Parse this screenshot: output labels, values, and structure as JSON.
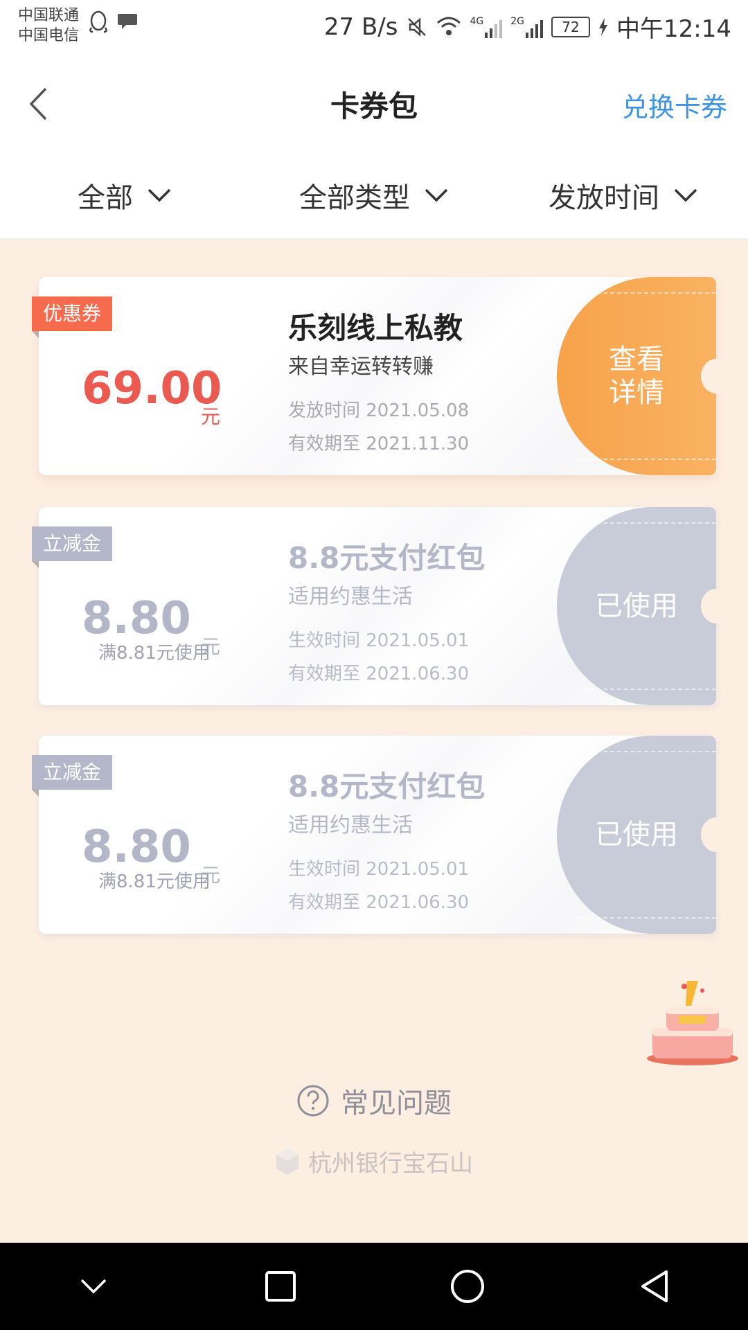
{
  "status_bar": {
    "carrier_1": "中国联通",
    "carrier_2": "中国电信",
    "speed": "27 B/s",
    "network_1": "4G",
    "network_2": "2G",
    "battery": "72",
    "time": "中午12:14",
    "icons": [
      "qq-icon",
      "chat-icon",
      "mute-icon",
      "wifi-icon",
      "signal-icon",
      "charging-icon"
    ]
  },
  "header": {
    "title": "卡券包",
    "redeem": "兑换卡券"
  },
  "filters": [
    {
      "label": "全部"
    },
    {
      "label": "全部类型"
    },
    {
      "label": "发放时间"
    }
  ],
  "cards": [
    {
      "tag": "优惠券",
      "amount": "69.00",
      "unit": "元",
      "condition": "",
      "title": "乐刻线上私教",
      "subtitle": "来自幸运转转赚",
      "date_1": "发放时间 2021.05.08",
      "date_2": "有效期至 2021.11.30",
      "stub_line_1": "查看",
      "stub_line_2": "详情",
      "status": "active"
    },
    {
      "tag": "立减金",
      "amount": "8.80",
      "unit": "元",
      "condition": "满8.81元使用",
      "title": "8.8元支付红包",
      "subtitle": "适用约惠生活",
      "date_1": "生效时间 2021.05.01",
      "date_2": "有效期至 2021.06.30",
      "stub_label": "已使用",
      "status": "used"
    },
    {
      "tag": "立减金",
      "amount": "8.80",
      "unit": "元",
      "condition": "满8.81元使用",
      "title": "8.8元支付红包",
      "subtitle": "适用约惠生活",
      "date_1": "生效时间 2021.05.01",
      "date_2": "有效期至 2021.06.30",
      "stub_label": "已使用",
      "status": "used"
    }
  ],
  "faq": "常见问题",
  "brand": "杭州银行宝石山",
  "colors": {
    "accent_blue": "#3d93e6",
    "coupon_red": "#ea5a50",
    "stub_orange": "#f7a24a",
    "used_grey": "#c8cbd8",
    "background": "#fdeee2"
  }
}
